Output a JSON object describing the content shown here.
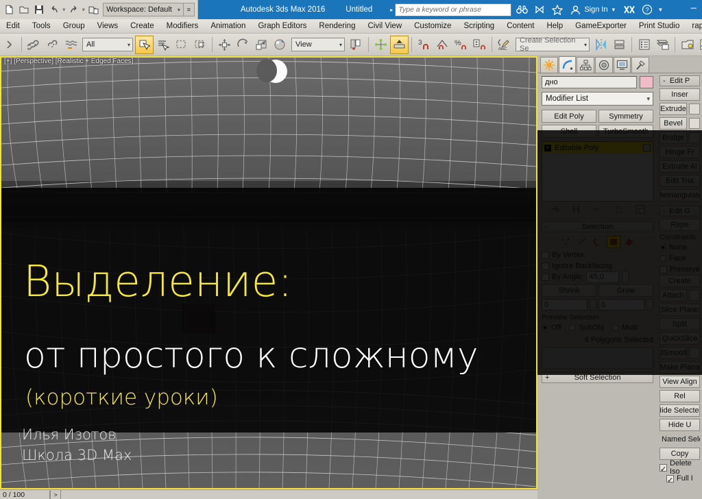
{
  "titlebar": {
    "workspace_label": "Workspace: Default",
    "app_title": "Autodesk 3ds Max 2016",
    "document_title": "Untitled",
    "search_placeholder": "Type a keyword or phrase",
    "sign_in_label": "Sign In",
    "quick_icons": [
      "new-icon",
      "open-icon",
      "save-icon",
      "undo-icon",
      "redo-icon",
      "project-folder-icon"
    ],
    "right_icons": [
      "binoculars-icon",
      "render-gallery-icon",
      "star-icon",
      "user-icon"
    ],
    "help_icon": "help-icon",
    "exchange_icon": "autodesk-exchange-icon",
    "minimize_label": "–"
  },
  "menubar": {
    "items": [
      "Edit",
      "Tools",
      "Group",
      "Views",
      "Create",
      "Modifiers",
      "Animation",
      "Graph Editors",
      "Rendering",
      "Civil View",
      "Customize",
      "Scripting",
      "Content",
      "Help",
      "GameExporter",
      "Print Studio",
      "rapidTools"
    ]
  },
  "toolbar": {
    "selection_filter_value": "All",
    "reference_coord_value": "View",
    "named_selection_placeholder": "Create Selection Se",
    "icons": [
      "undo-arrow-icon",
      "select-link-icon",
      "unlink-icon",
      "bind-space-warp-icon",
      "select-object-icon",
      "select-by-name-icon",
      "rectangular-region-icon",
      "window-crossing-icon",
      "select-and-move-icon",
      "select-and-rotate-icon",
      "select-and-scale-icon",
      "select-and-place-icon",
      "use-center-icon",
      "select-and-manipulate-icon",
      "snap-toggle-icon",
      "angle-snap-icon",
      "percent-snap-icon",
      "spinner-snap-icon",
      "edit-named-selection-icon",
      "mirror-icon",
      "align-icon",
      "layer-manager-icon",
      "curve-editor-icon",
      "schematic-view-icon",
      "material-editor-icon",
      "render-setup-icon"
    ]
  },
  "viewport": {
    "label": "[+] [Perspective] [Realistic + Edged Faces]",
    "slide": {
      "title": "Выделение:",
      "subtitle": "от простого к сложному",
      "note": "(короткие уроки)",
      "author_name": "Илья Изотов",
      "author_school": "Школа 3D Max",
      "title_color": "#f5e73e",
      "note_color": "#f0e44a",
      "subtitle_color": "#ffffff"
    }
  },
  "command_panel": {
    "tabs": [
      {
        "name": "create-tab",
        "icon": "star-burst-icon"
      },
      {
        "name": "modify-tab",
        "icon": "modify-curve-icon"
      },
      {
        "name": "hierarchy-tab",
        "icon": "hierarchy-icon"
      },
      {
        "name": "motion-tab",
        "icon": "motion-wheel-icon"
      },
      {
        "name": "display-tab",
        "icon": "display-monitor-icon"
      },
      {
        "name": "utilities-tab",
        "icon": "hammer-icon"
      }
    ],
    "active_tab_index": 1,
    "object_name": "дно",
    "object_color": "#f0bcc8",
    "modifier_list_label": "Modifier List",
    "modifier_buttons": [
      "Edit Poly",
      "Symmetry",
      "Shell",
      "TurboSmooth"
    ],
    "stack_items": [
      {
        "label": "Editable Poly",
        "highlighted": true
      }
    ],
    "stack_icons": [
      "pin-stack-icon",
      "show-end-result-icon",
      "make-unique-icon",
      "remove-modifier-icon",
      "configure-sets-icon"
    ],
    "selection_rollout": {
      "title": "Selection",
      "sub_object_icons": [
        "vertex-icon",
        "edge-icon",
        "border-icon",
        "polygon-icon",
        "element-icon"
      ],
      "active_sub_object": "polygon-icon",
      "by_vertex_label": "By Vertex",
      "ignore_backfacing_label": "Ignore Backfacing",
      "by_angle_label": "By Angle:",
      "by_angle_value": "45,0",
      "shrink_label": "Shrink",
      "grow_label": "Grow",
      "ring_value": "0",
      "loop_value": "0",
      "preview_selection_label": "Preview Selection",
      "preview_off_label": "Off",
      "preview_subobj_label": "SubObj",
      "preview_multi_label": "Multi",
      "status_text": "6 Polygons Selected"
    },
    "soft_selection_label": "Soft Selection",
    "edit_polygons_rollout": {
      "title": "Edit P",
      "buttons": [
        "Inser",
        "Extrude",
        "Bevel",
        "Bridge",
        "Hinge Fr",
        "Extrude Al",
        "Edit Tria",
        "Retriangulate"
      ]
    },
    "edit_geometry_rollout": {
      "title": "Edit G",
      "repeat_label": "Repe",
      "constraints_label": "Constraints",
      "constraint_none": "None",
      "constraint_face": "Face",
      "preserve_uvs_label": "Preserve",
      "create_label": "Create",
      "attach_label": "Attach",
      "slice_plane_label": "Slice Plane",
      "split_label": "Split",
      "quickslice_label": "QuickSlice",
      "msmooth_label": "MSmooth",
      "make_planar_label": "Make Plana",
      "view_align_label": "View Align",
      "relax_label": "Rel",
      "hide_selected_label": "Hide Selected",
      "hide_unselected_label": "Hide U",
      "named_selection_label": "Named Select",
      "copy_label": "Copy",
      "delete_isolated_label": "Delete Iso",
      "full_interactivity_label": "Full I"
    }
  },
  "statusbar": {
    "frame_counter": "0 / 100",
    "next_button": ">"
  }
}
